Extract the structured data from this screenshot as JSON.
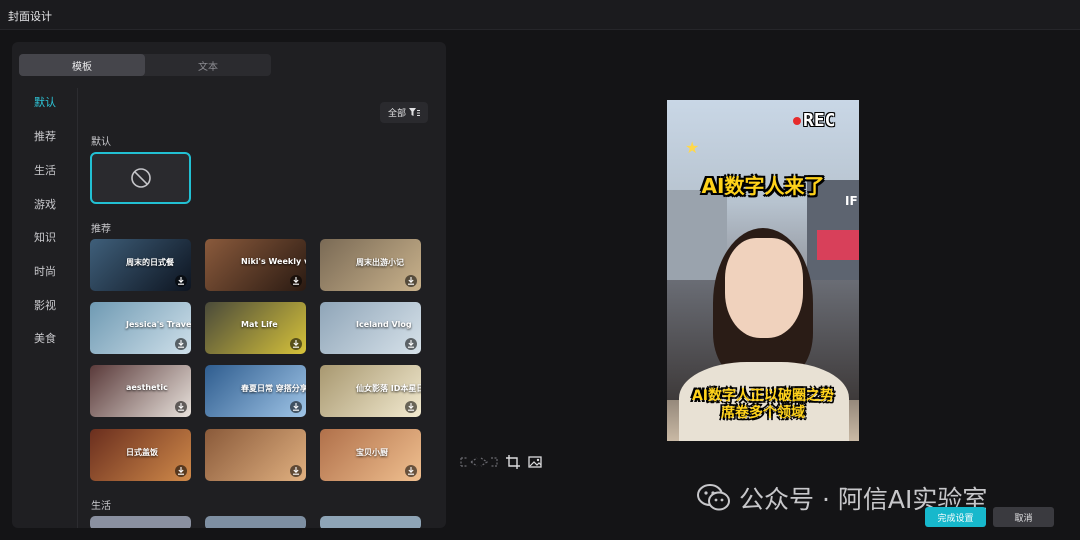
{
  "window": {
    "title": "封面设计"
  },
  "tabs": [
    {
      "label": "模板",
      "active": true
    },
    {
      "label": "文本",
      "active": false
    }
  ],
  "categories": [
    "默认",
    "推荐",
    "生活",
    "游戏",
    "知识",
    "时尚",
    "影视",
    "美食"
  ],
  "filter": {
    "label": "全部",
    "icon": "filter-icon"
  },
  "sections": {
    "default": "默认",
    "recommend": "推荐",
    "life": "生活"
  },
  "templates": [
    {
      "caption": "周末的日式餐",
      "bg": "#3f5f7a",
      "accent": "#0d1420"
    },
    {
      "caption": "Niki's Weekly vlog",
      "bg": "#8a5a3c",
      "accent": "#2a1a12"
    },
    {
      "caption": "周末出游小记",
      "bg": "#7a6a55",
      "accent": "#c9b28c"
    },
    {
      "caption": "Jessica's Travel Vlog",
      "bg": "#6f9ab3",
      "accent": "#cfe0ea"
    },
    {
      "caption": "Mat Life",
      "bg": "#4a4a3a",
      "accent": "#d6c23a"
    },
    {
      "caption": "Iceland Vlog",
      "bg": "#8fa5b8",
      "accent": "#d7e2ea"
    },
    {
      "caption": "aesthetic",
      "bg": "#5a3a3a",
      "accent": "#e8e2dc"
    },
    {
      "caption": "春夏日常 穿搭分享",
      "bg": "#2f5d8f",
      "accent": "#9fc4e6"
    },
    {
      "caption": "仙女影落 ID本星日记",
      "bg": "#a89870",
      "accent": "#f2ead0"
    },
    {
      "caption": "日式盖饭",
      "bg": "#6a2e1e",
      "accent": "#d08a4a"
    },
    {
      "caption": "",
      "bg": "#8a5a3a",
      "accent": "#e0b080"
    },
    {
      "caption": "宝贝小厨",
      "bg": "#b0704a",
      "accent": "#f0c090"
    }
  ],
  "preview": {
    "rec": "REC",
    "headline": "AI数字人来了",
    "subline1": "AI数字人正以破圈之势",
    "subline2": "席卷多个领域",
    "sign": "IF"
  },
  "tools": [
    "ratio-icon",
    "crop-icon",
    "replace-image-icon"
  ],
  "watermark": {
    "text": "公众号 · 阿信AI实验室",
    "icon": "wechat-icon"
  },
  "buttons": {
    "confirm": "完成设置",
    "cancel": "取消"
  }
}
